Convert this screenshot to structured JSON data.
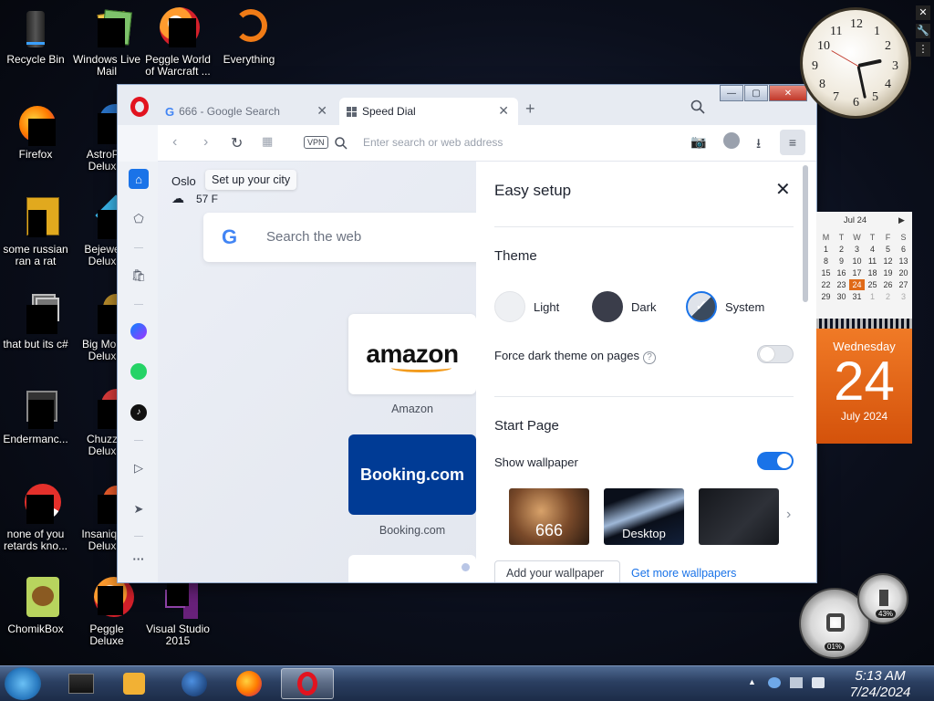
{
  "desktop": {
    "icons": [
      {
        "label": "Recycle Bin"
      },
      {
        "label": "Windows Live Mail"
      },
      {
        "label": "Peggle World of Warcraft ..."
      },
      {
        "label": "Everything"
      },
      {
        "label": "Firefox"
      },
      {
        "label": "AstroP... Delux..."
      },
      {
        "label": "some russian ran a rat"
      },
      {
        "label": "Bejewe... Delux..."
      },
      {
        "label": "that but its c#"
      },
      {
        "label": "Big Mon... Delux..."
      },
      {
        "label": "Endermanc..."
      },
      {
        "label": "Chuzz... Delux..."
      },
      {
        "label": "none of you retards kno..."
      },
      {
        "label": "Insaniqu... Delux..."
      },
      {
        "label": "ChomikBox"
      },
      {
        "label": "Peggle Deluxe"
      },
      {
        "label": "Visual Studio 2015"
      }
    ]
  },
  "browser": {
    "tabs": [
      {
        "label": "666 - Google Search",
        "icon": "google-g-icon"
      },
      {
        "label": "Speed Dial",
        "icon": "grid-icon"
      }
    ],
    "new_tab": "+",
    "window_controls": {
      "minimize": "—",
      "maximize": "▢",
      "close": "✕"
    },
    "address_bar": {
      "placeholder": "Enter search or web address",
      "vpn": "VPN"
    },
    "weather": {
      "city": "Oslo",
      "temp": "57 F",
      "set_city": "Set up your city"
    },
    "search": {
      "placeholder": "Search the web",
      "logo": "G"
    },
    "speed_dial": [
      {
        "label": "Amazon",
        "logo": "amazon"
      },
      {
        "label": "Booking.com",
        "logo": "Booking.com"
      }
    ],
    "easy_setup": {
      "title": "Easy setup",
      "theme_heading": "Theme",
      "themes": [
        {
          "label": "Light",
          "color": "#eef0f3"
        },
        {
          "label": "Dark",
          "color": "#3a3d4a"
        },
        {
          "label": "System",
          "color": "#3a4a5e"
        }
      ],
      "force_dark_label": "Force dark theme on pages",
      "force_dark_on": false,
      "start_page_heading": "Start Page",
      "show_wallpaper_label": "Show wallpaper",
      "show_wallpaper_on": true,
      "wallpapers": [
        {
          "label": "666"
        },
        {
          "label": "Desktop"
        },
        {
          "label": ""
        }
      ],
      "add_wallpaper": "Add your wallpaper",
      "get_more": "Get more wallpapers"
    }
  },
  "calendar": {
    "month": "Jul 24",
    "headers": [
      "M",
      "T",
      "W",
      "T",
      "F",
      "S"
    ],
    "rows": [
      [
        "1",
        "2",
        "3",
        "4",
        "5",
        "6"
      ],
      [
        "8",
        "9",
        "10",
        "11",
        "12",
        "13"
      ],
      [
        "15",
        "16",
        "17",
        "18",
        "19",
        "20"
      ],
      [
        "22",
        "23",
        "24",
        "25",
        "26",
        "27"
      ],
      [
        "29",
        "30",
        "31",
        "1",
        "2",
        "3"
      ]
    ],
    "weekday": "Wednesday",
    "day": "24",
    "month_year": "July 2024"
  },
  "clock_numbers": [
    "12",
    "1",
    "2",
    "3",
    "4",
    "5",
    "6",
    "7",
    "8",
    "9",
    "10",
    "11"
  ],
  "meters": {
    "cpu": "01%",
    "ram": "43%"
  },
  "taskbar": {
    "time": "5:13 AM",
    "date": "7/24/2024"
  },
  "colors": {
    "accent": "#1a73e8",
    "opera_red": "#e2131f",
    "calendar_orange": "#e06a18"
  }
}
